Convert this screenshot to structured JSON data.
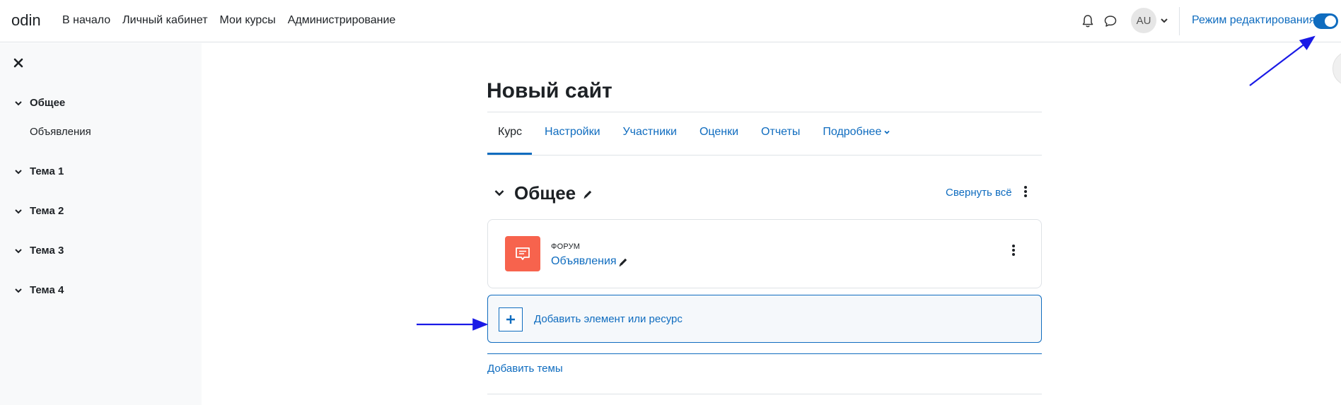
{
  "navbar": {
    "brand": "odin",
    "items": [
      "В начало",
      "Личный кабинет",
      "Мои курсы",
      "Администрирование"
    ],
    "avatar_initials": "AU",
    "edit_mode_label": "Режим редактирования",
    "edit_mode_on": true
  },
  "drawer": {
    "sections": [
      {
        "label": "Общее",
        "items": [
          "Объявления"
        ]
      },
      {
        "label": "Тема 1"
      },
      {
        "label": "Тема 2"
      },
      {
        "label": "Тема 3"
      },
      {
        "label": "Тема 4"
      }
    ]
  },
  "course": {
    "title": "Новый сайт",
    "tabs": [
      "Курс",
      "Настройки",
      "Участники",
      "Оценки",
      "Отчеты",
      "Подробнее"
    ],
    "section_title": "Общее",
    "collapse_all": "Свернуть всё",
    "activity": {
      "type": "ФОРУМ",
      "name": "Объявления"
    },
    "add_resource": "Добавить элемент или ресурс",
    "add_topics": "Добавить темы"
  },
  "colors": {
    "accent": "#0f6cbf",
    "forum": "#f7634d",
    "drawer_bg": "#f8f9fa",
    "arrow": "#1a1ae6"
  }
}
